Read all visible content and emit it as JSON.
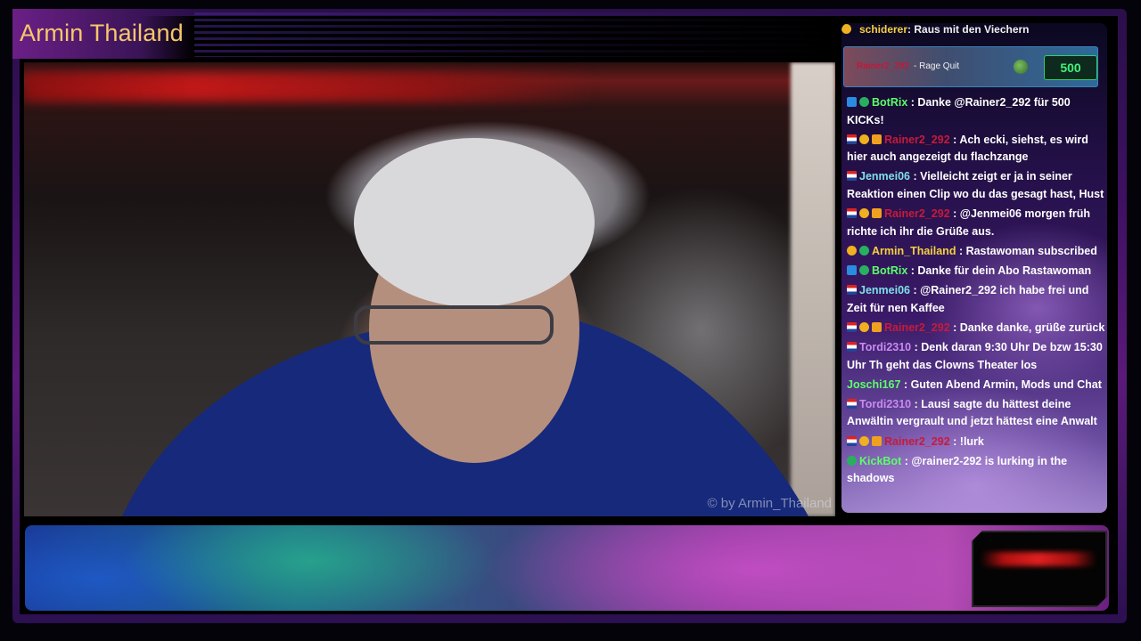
{
  "overlay": {
    "title": "Armin Thailand",
    "watermark": "© by Armin_Thailand"
  },
  "chat": {
    "top_line": {
      "user": "schiderer",
      "text": ": Raus mit den Viechern"
    },
    "alert": {
      "user": "Rainer2_292",
      "note": "- Rage Quit",
      "kicks": "500"
    },
    "messages": [
      {
        "badges": [
          "b-bot",
          "b-check"
        ],
        "user": "BotRix",
        "color": "#5cff6a",
        "text": ": Danke @Rainer2_292 für 500 KICKs!"
      },
      {
        "badges": [
          "b-flag",
          "b-coin",
          "b-crown"
        ],
        "user": "Rainer2_292",
        "color": "#c81a3a",
        "text": ": Ach ecki, siehst, es wird hier auch angezeigt du flachzange"
      },
      {
        "badges": [
          "b-flag"
        ],
        "user": "Jenmei06",
        "color": "#7ee0e8",
        "text": ": Vielleicht zeigt er ja in seiner Reaktion einen Clip wo du das gesagt hast, Hust"
      },
      {
        "badges": [
          "b-flag",
          "b-coin",
          "b-crown"
        ],
        "user": "Rainer2_292",
        "color": "#c81a3a",
        "text": ": @Jenmei06 morgen früh richte ich ihr die Grüße aus."
      },
      {
        "badges": [
          "b-coin",
          "b-check"
        ],
        "user": "Armin_Thailand",
        "color": "#f4d040",
        "text": ": Rastawoman subscribed"
      },
      {
        "badges": [
          "b-bot",
          "b-check"
        ],
        "user": "BotRix",
        "color": "#5cff6a",
        "text": ": Danke für dein Abo Rastawoman"
      },
      {
        "badges": [
          "b-flag"
        ],
        "user": "Jenmei06",
        "color": "#7ee0e8",
        "text": ": @Rainer2_292 ich habe frei und Zeit für nen Kaffee"
      },
      {
        "badges": [
          "b-flag",
          "b-coin",
          "b-crown"
        ],
        "user": "Rainer2_292",
        "color": "#c81a3a",
        "text": ": Danke danke, grüße zurück"
      },
      {
        "badges": [
          "b-flag"
        ],
        "user": "Tordi2310",
        "color": "#c98af0",
        "text": ": Denk daran 9:30 Uhr De bzw 15:30 Uhr Th geht das Clowns Theater los"
      },
      {
        "badges": [],
        "user": "Joschi167",
        "color": "#5cff6a",
        "text": ": Guten Abend Armin, Mods und Chat"
      },
      {
        "badges": [
          "b-flag"
        ],
        "user": "Tordi2310",
        "color": "#c98af0",
        "text": ": Lausi sagte du hättest deine Anwältin vergrault und jetzt hättest eine Anwalt"
      },
      {
        "badges": [
          "b-flag",
          "b-coin",
          "b-crown"
        ],
        "user": "Rainer2_292",
        "color": "#c81a3a",
        "text": ": !lurk"
      },
      {
        "badges": [
          "b-check"
        ],
        "user": "KickBot",
        "color": "#5cff6a",
        "text": ": @rainer2-292 is lurking in the shadows"
      }
    ]
  }
}
